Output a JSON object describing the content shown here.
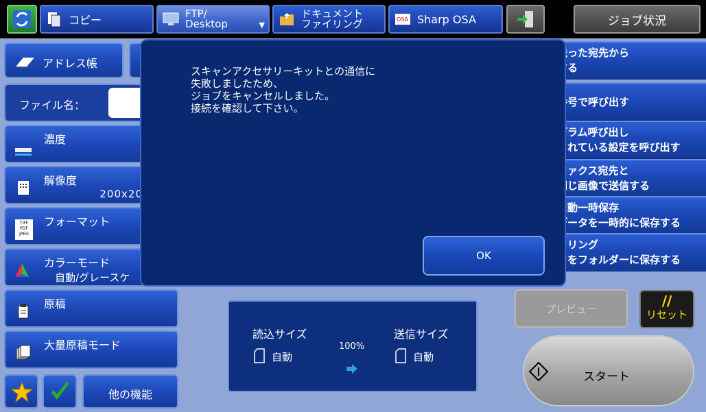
{
  "topbar": {
    "home_label": "",
    "copy_label": "コピー",
    "ftp_line1": "FTP/",
    "ftp_line2": "Desktop",
    "docfiling_line1": "ドキュメント",
    "docfiling_line2": "ファイリング",
    "sharp_osa_label": "Sharp OSA",
    "job_status_label": "ジョブ状況"
  },
  "left": {
    "address_book": "アドレス帳",
    "file_name_label": "ファイル名：",
    "density_label": "濃度",
    "resolution_label": "解像度",
    "resolution_value": "200x20",
    "format_label": "フォーマット",
    "format_icon_text": [
      "TIFF",
      "PDF",
      "JPEG"
    ],
    "color_mode_label": "カラーモード",
    "color_mode_value": "自動/グレースケ",
    "original_label": "原稿",
    "bulk_mode_label": "大量原稿モード",
    "other_functions_label": "他の機能"
  },
  "right": {
    "items": [
      {
        "line1": "送った宛先から",
        "line2": "する"
      },
      {
        "line1": "番号で呼び出す",
        "line2": ""
      },
      {
        "line1": "グラム呼び出し",
        "line2": "されている設定を呼び出す"
      },
      {
        "line1": "ファクス宛先と",
        "line2": "同じ画像で送信する"
      },
      {
        "line1": "自動一時保存",
        "line2": "データを一時的に保存する"
      },
      {
        "line1": "イリング",
        "line2": "タをフォルダーに保存する"
      }
    ]
  },
  "sizes": {
    "read_size_label": "読込サイズ",
    "read_size_value": "自動",
    "ratio": "100%",
    "send_size_label": "送信サイズ",
    "send_size_value": "自動"
  },
  "dialog": {
    "message": "スキャンアクセサリーキットとの通信に\n失敗しましたため、\nジョブをキャンセルしました。\n接続を確認して下さい。",
    "ok_label": "OK"
  },
  "actions": {
    "preview_label": "プレビュー",
    "reset_mark": "//",
    "reset_label": "リセット",
    "start_label": "スタート"
  }
}
